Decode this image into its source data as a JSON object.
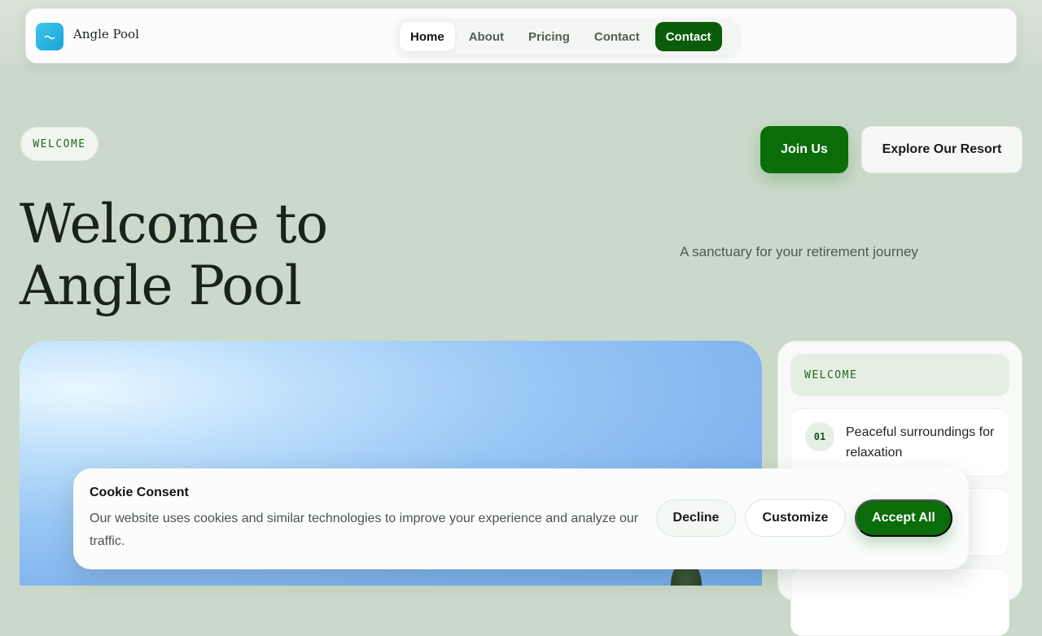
{
  "brand": {
    "name": "Angle Pool",
    "logo_icon": "pool-icon",
    "logo_color": "#1aa3d8"
  },
  "nav": {
    "items": [
      {
        "label": "Home",
        "active": true
      },
      {
        "label": "About"
      },
      {
        "label": "Pricing"
      },
      {
        "label": "Contact"
      }
    ],
    "cta_label": "Contact"
  },
  "hero": {
    "eyebrow": "WELCOME",
    "title_line1": "Welcome to",
    "title_line2": "Angle Pool",
    "subtitle": "A sanctuary for your retirement journey",
    "primary_cta": "Join Us",
    "secondary_cta": "Explore Our Resort"
  },
  "side_panel": {
    "header": "WELCOME",
    "features": [
      {
        "num": "01",
        "text": "Peaceful surroundings for relaxation"
      }
    ]
  },
  "cookie": {
    "title": "Cookie Consent",
    "text": "Our website uses cookies and similar technologies to improve your experience and analyze our traffic.",
    "decline": "Decline",
    "customize": "Customize",
    "accept": "Accept All"
  },
  "colors": {
    "accent": "#0a6d0a",
    "background": "#cad9c9",
    "nav_cta": "#0a5c0a"
  }
}
